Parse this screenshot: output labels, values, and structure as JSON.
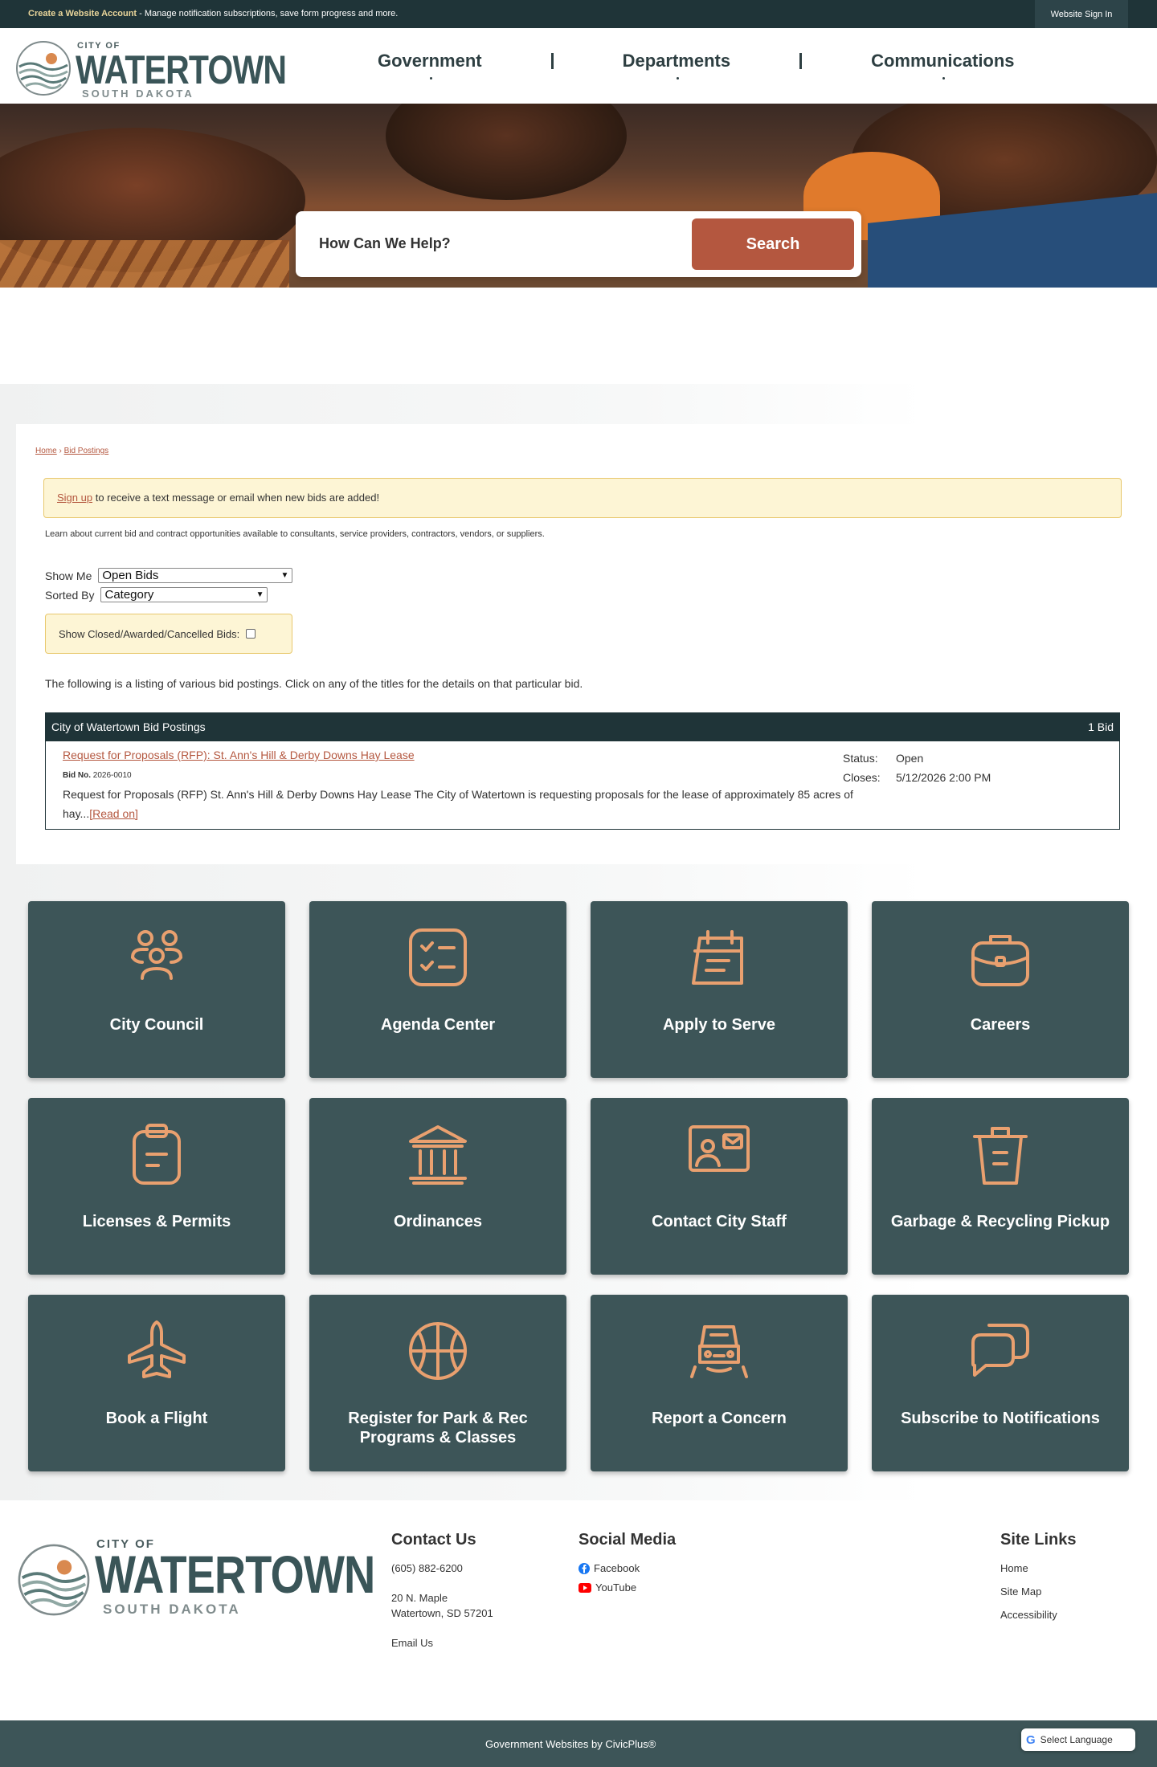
{
  "topbar": {
    "create_link": "Create a Website Account",
    "message": " - Manage notification subscriptions, save form progress and more.",
    "sign_in": "Website Sign In"
  },
  "logo": {
    "city_of": "CITY OF",
    "name": "WATERTOWN",
    "state": "SOUTH DAKOTA"
  },
  "nav": [
    "Government",
    "Departments",
    "Communications"
  ],
  "search": {
    "placeholder": "How Can We Help?",
    "button": "Search"
  },
  "breadcrumb": {
    "home": "Home",
    "sep": " › ",
    "current": "Bid Postings"
  },
  "notice": {
    "link": "Sign up",
    "text": " to receive a text message or email when new bids are added!"
  },
  "intro": "Learn about current bid and contract opportunities available to consultants, service providers, contractors, vendors, or suppliers.",
  "filters": {
    "show_me_label": "Show Me",
    "show_me_value": "Open Bids",
    "sorted_by_label": "Sorted By",
    "sorted_by_value": "Category",
    "closed_label": "Show Closed/Awarded/Cancelled Bids:"
  },
  "listing_text": "The following is a listing of various bid postings. Click on any of the titles for the details on that particular bid.",
  "bids": {
    "header": "City of Watertown Bid Postings",
    "count": "1 Bid",
    "items": [
      {
        "title": "Request for Proposals (RFP): St. Ann's Hill & Derby Downs Hay Lease",
        "bid_no_label": "Bid No.",
        "bid_no": "2026-0010",
        "description": "Request for Proposals (RFP) St. Ann's Hill & Derby Downs Hay Lease The City of Watertown is requesting proposals for the lease of approximately 85 acres of hay...",
        "read_on": "[Read on]",
        "status_label": "Status:",
        "status": "Open",
        "closes_label": "Closes:",
        "closes": "5/12/2026 2:00 PM"
      }
    ]
  },
  "tiles": [
    {
      "label": "City Council",
      "icon": "people-icon"
    },
    {
      "label": "Agenda Center",
      "icon": "checklist-icon"
    },
    {
      "label": "Apply to Serve",
      "icon": "calendar-icon"
    },
    {
      "label": "Careers",
      "icon": "briefcase-icon"
    },
    {
      "label": "Licenses & Permits",
      "icon": "clipboard-icon"
    },
    {
      "label": "Ordinances",
      "icon": "building-icon"
    },
    {
      "label": "Contact City Staff",
      "icon": "contact-card-icon"
    },
    {
      "label": "Garbage & Recycling Pickup",
      "icon": "trash-icon"
    },
    {
      "label": "Book a Flight",
      "icon": "plane-icon"
    },
    {
      "label": "Register for Park & Rec Programs & Classes",
      "icon": "basketball-icon"
    },
    {
      "label": "Report a Concern",
      "icon": "snowplow-icon"
    },
    {
      "label": "Subscribe to Notifications",
      "icon": "chat-icon"
    }
  ],
  "footer": {
    "contact": {
      "heading": "Contact Us",
      "phone": "(605) 882-6200",
      "address1": "20 N. Maple",
      "address2": "Watertown, SD 57201",
      "email": "Email Us"
    },
    "social": {
      "heading": "Social Media",
      "facebook": "Facebook",
      "youtube": "YouTube"
    },
    "sitelinks": {
      "heading": "Site Links",
      "items": [
        "Home",
        "Site Map",
        "Accessibility"
      ]
    },
    "credit": "Government Websites by CivicPlus®",
    "language": "Select Language"
  },
  "colors": {
    "accent": "#b4573f",
    "teal": "#3d5558",
    "dark": "#1f3438",
    "icon": "#e9a06f"
  }
}
